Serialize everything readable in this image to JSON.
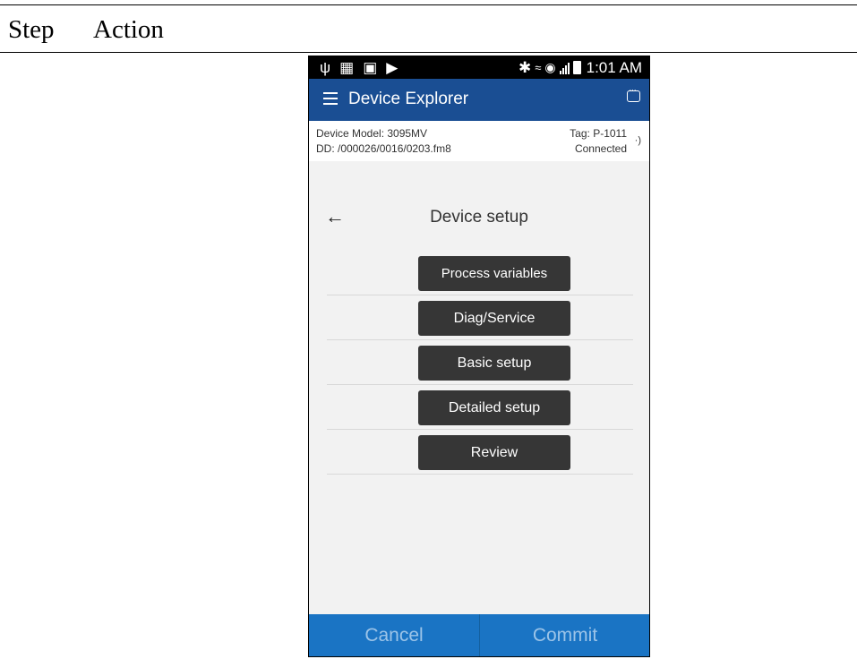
{
  "document": {
    "col_step": "Step",
    "col_action": "Action"
  },
  "statusbar": {
    "time": "1:01 AM",
    "left_icons": [
      "usb-icon",
      "sd-card-icon",
      "image-icon",
      "play-store-icon"
    ],
    "right_icons": [
      "bluetooth-icon",
      "nfc-mute-icon",
      "wifi-icon",
      "signal-icon",
      "battery-charging-icon"
    ]
  },
  "appbar": {
    "title": "Device Explorer",
    "menu_icon": "hamburger-icon",
    "action_icon": "chat-icon"
  },
  "device_info": {
    "model_label": "Device Model:  3095MV",
    "dd_label": "DD:  /000026/0016/0203.fm8",
    "tag_label": "Tag:  P-1011",
    "status": "Connected",
    "rf_icon": "wireless-icon"
  },
  "screen": {
    "back_symbol": "←",
    "title": "Device setup",
    "menu_items": [
      {
        "label": "Process variables"
      },
      {
        "label": "Diag/Service"
      },
      {
        "label": "Basic setup"
      },
      {
        "label": "Detailed setup"
      },
      {
        "label": "Review"
      }
    ]
  },
  "bottombar": {
    "cancel": "Cancel",
    "commit": "Commit"
  },
  "colors": {
    "appbar": "#1a4e93",
    "bottombar": "#1a74c4",
    "menu_button": "#363636",
    "screen_bg": "#f2f2f2"
  }
}
